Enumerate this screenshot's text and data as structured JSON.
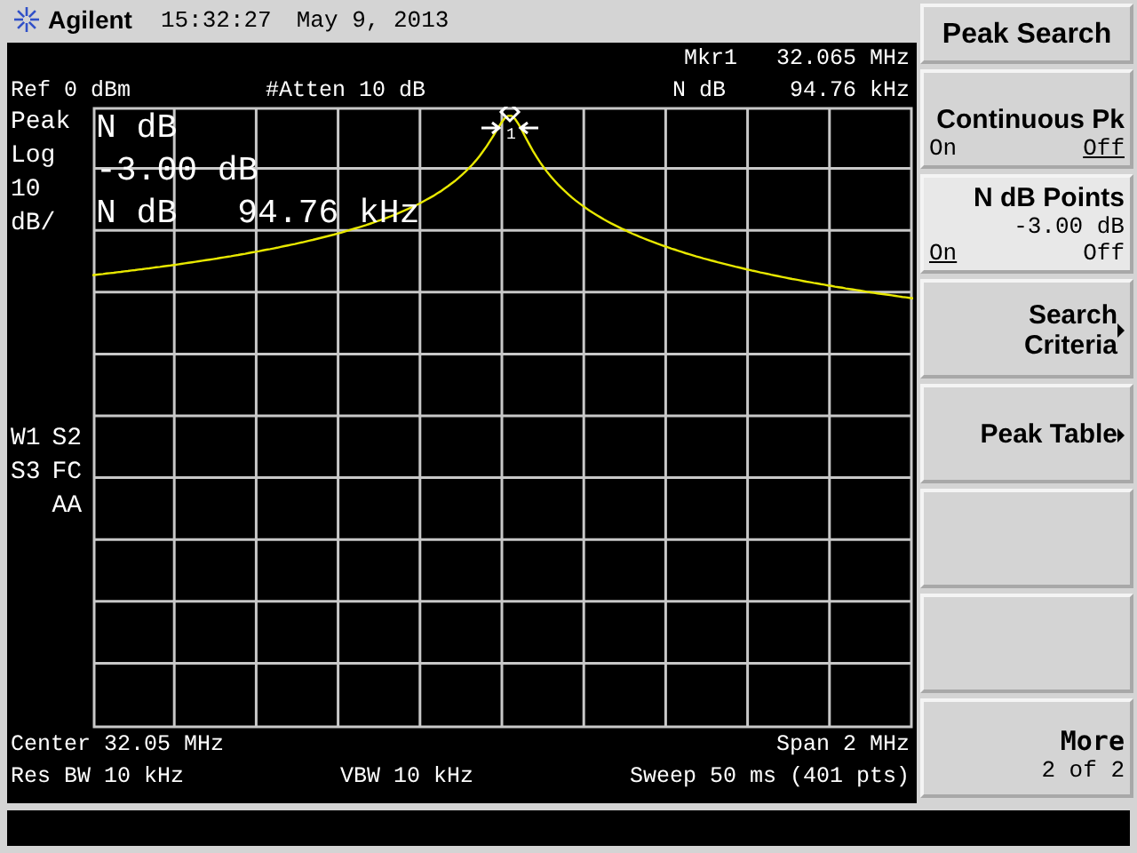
{
  "header": {
    "brand": "Agilent",
    "time": "15:32:27",
    "date": "May 9, 2013"
  },
  "screen": {
    "marker_label": "Mkr1",
    "marker_value": "32.065 MHz",
    "ref": "Ref 0 dBm",
    "atten": "#Atten 10 dB",
    "ndb_label": "N dB",
    "ndb_value": "94.76 kHz",
    "scale": [
      "Peak",
      "Log",
      "10",
      "dB/"
    ],
    "flags": [
      {
        "left": "W1",
        "right": "S2"
      },
      {
        "left": "S3",
        "right": "FC"
      },
      {
        "right": "AA"
      }
    ],
    "overlay": {
      "title": "N dB",
      "level": "-3.00 dB",
      "result_label": "N dB",
      "result_value": "94.76 kHz"
    },
    "marker_number": "1",
    "center": "Center 32.05 MHz",
    "span": "Span 2 MHz",
    "res_bw": "Res BW 10 kHz",
    "vbw": "VBW 10 kHz",
    "sweep": "Sweep 50 ms (401 pts)"
  },
  "softkeys": [
    {
      "kind": "title",
      "label": "Peak Search"
    },
    {
      "kind": "toggle",
      "label": "Continuous Pk",
      "on_label": "On",
      "off_label": "Off",
      "on": false,
      "active": false
    },
    {
      "kind": "toggle",
      "label": "N dB Points",
      "value": "-3.00 dB",
      "on_label": "On",
      "off_label": "Off",
      "on": true,
      "active": true
    },
    {
      "kind": "submenu",
      "lines": [
        "Search",
        "Criteria"
      ]
    },
    {
      "kind": "submenu",
      "lines": [
        "Peak Table"
      ]
    },
    {
      "kind": "blank"
    },
    {
      "kind": "blank"
    },
    {
      "kind": "more",
      "label": "More",
      "page": "2 of 2"
    }
  ]
}
